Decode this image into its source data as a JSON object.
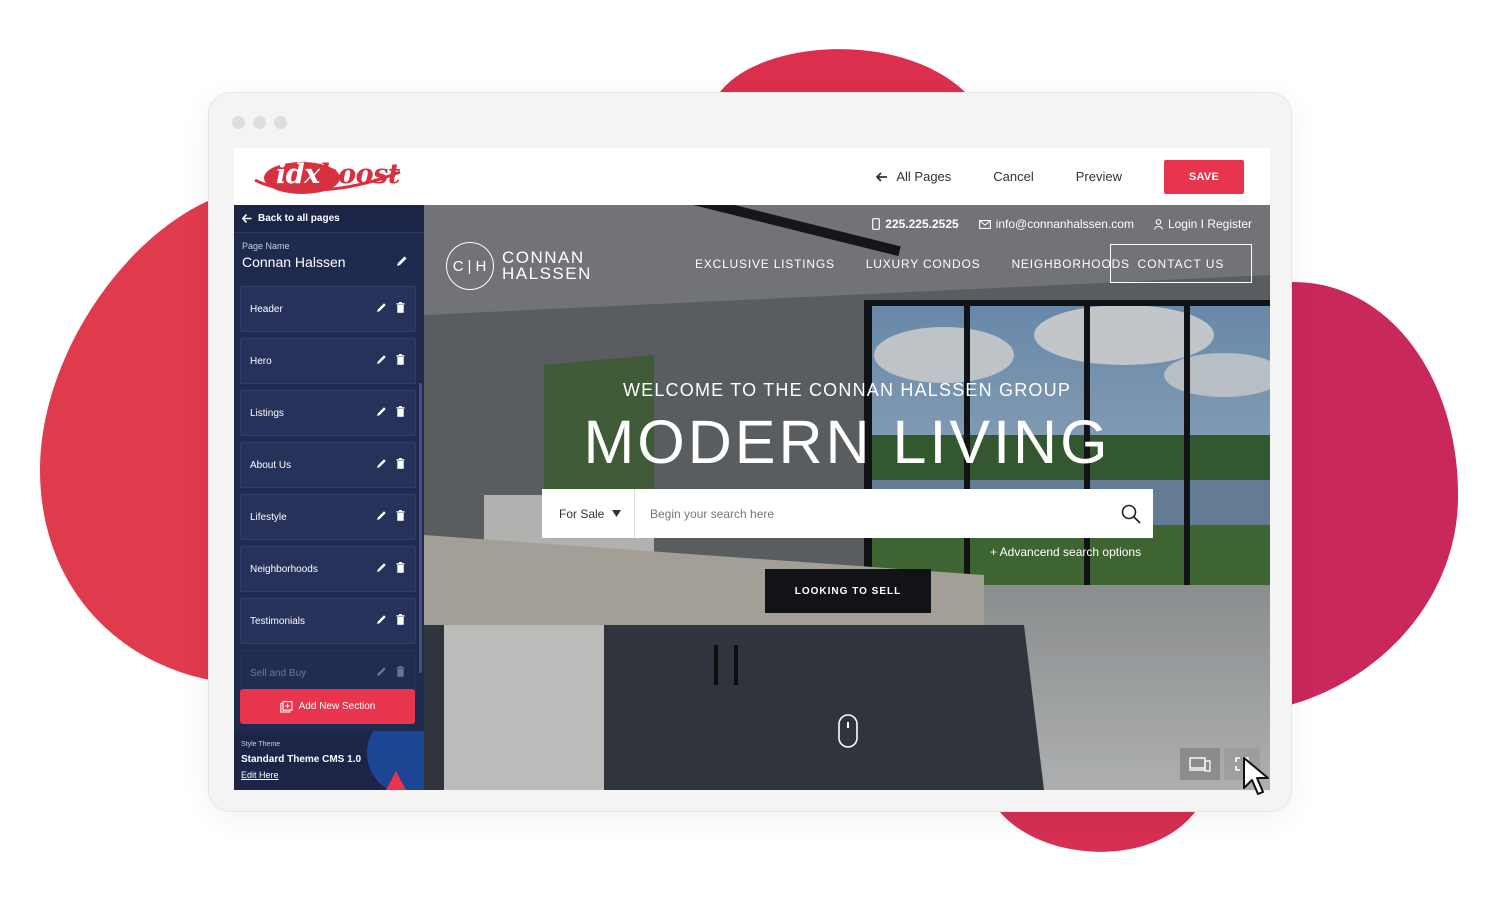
{
  "editor": {
    "brand": {
      "logo_text": "boost",
      "logo_prefix": "idx"
    },
    "topbar": {
      "all_pages_label": "All Pages",
      "cancel_label": "Cancel",
      "preview_label": "Preview",
      "save_label": "SAVE"
    },
    "sidebar": {
      "back_label": "Back to all pages",
      "page_name_label": "Page Name",
      "page_name_value": "Connan Halssen",
      "sections": [
        {
          "label": "Header"
        },
        {
          "label": "Hero"
        },
        {
          "label": "Listings"
        },
        {
          "label": "About Us"
        },
        {
          "label": "Lifestyle"
        },
        {
          "label": "Neighborhoods"
        },
        {
          "label": "Testimonials"
        },
        {
          "label": "Sell and Buy"
        }
      ],
      "add_section_label": "Add New Section",
      "style_theme_label": "Style Theme",
      "style_theme_value": "Standard Theme CMS 1.0",
      "edit_label": "Edit Here"
    }
  },
  "site": {
    "phone": "225.225.2525",
    "email": "info@connanhalssen.com",
    "login": "Login I Register",
    "logo_initials_left": "C",
    "logo_initials_right": "H",
    "logo_line1": "CONNAN",
    "logo_line2": "HALSSEN",
    "nav": [
      "EXCLUSIVE LISTINGS",
      "LUXURY CONDOS",
      "NEIGHBORHOODS"
    ],
    "contact_label": "CONTACT US",
    "welcome": "WELCOME TO THE CONNAN HALSSEN GROUP",
    "headline": "MODERN LIVING",
    "search": {
      "type_value": "For Sale",
      "placeholder": "Begin your search here",
      "advanced_label": "+ Advancend search options"
    },
    "sell_label": "LOOKING TO SELL"
  },
  "colors": {
    "accent": "#e8344d",
    "blob": "#dc2f4e",
    "sidebar": "#1f2a4f",
    "sell_button": "#111318"
  },
  "icons": [
    "arrow-left-icon",
    "pencil-icon",
    "trash-icon",
    "add-section-icon",
    "phone-icon",
    "mail-icon",
    "user-icon",
    "search-icon",
    "caret-down-icon",
    "mouse-scroll-icon",
    "devices-icon",
    "expand-icon",
    "cursor-icon"
  ]
}
